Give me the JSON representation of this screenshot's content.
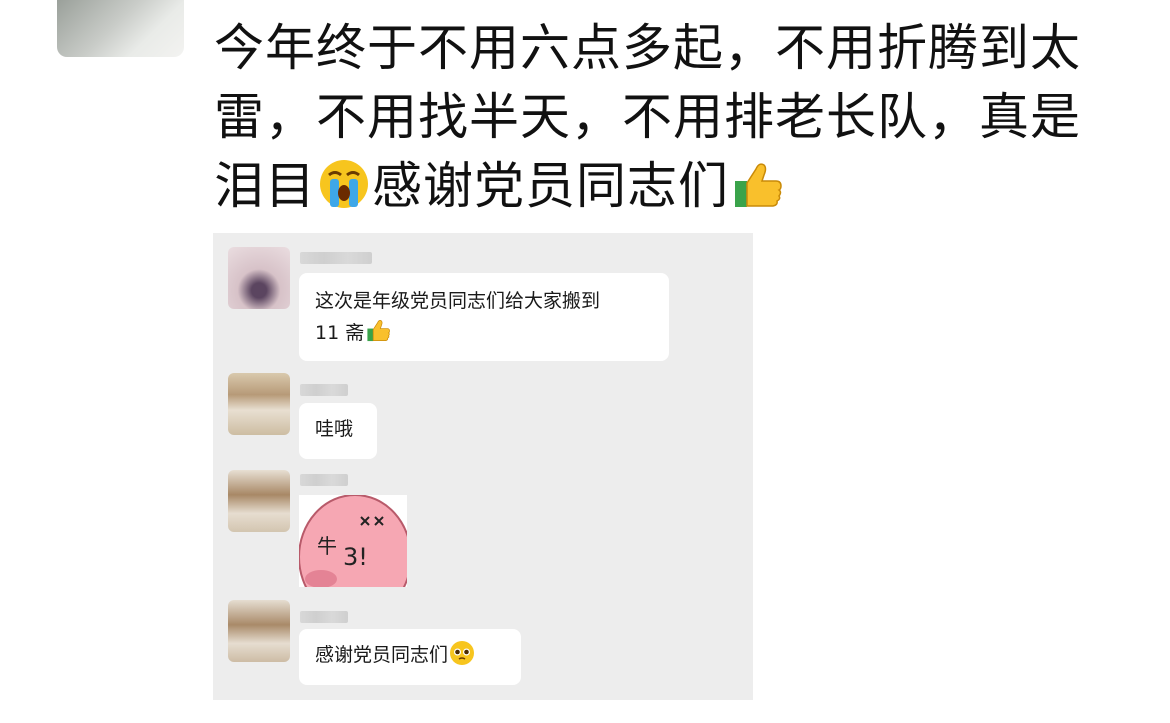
{
  "post": {
    "line1": "今年终于不用六点多起，不用折腾到太",
    "line2": "雷，不用找半天，不用排老长队，真是",
    "line3_a": "泪目",
    "line3_b": "感谢党员同志们",
    "emoji_1": "loudly-crying-face",
    "emoji_2": "thumbs-up"
  },
  "chat_screenshot": {
    "messages": [
      {
        "line1": "这次是年级党员同志们给大家搬到",
        "line2": "11 斋",
        "emoji": "thumbs-up"
      },
      {
        "text": "哇哦"
      },
      {
        "sticker_text_1": "牛",
        "sticker_text_2": "3!",
        "sticker_desc": "pink-blob-sticker"
      },
      {
        "text": "感谢党员同志们",
        "emoji": "pleading-face"
      }
    ]
  }
}
